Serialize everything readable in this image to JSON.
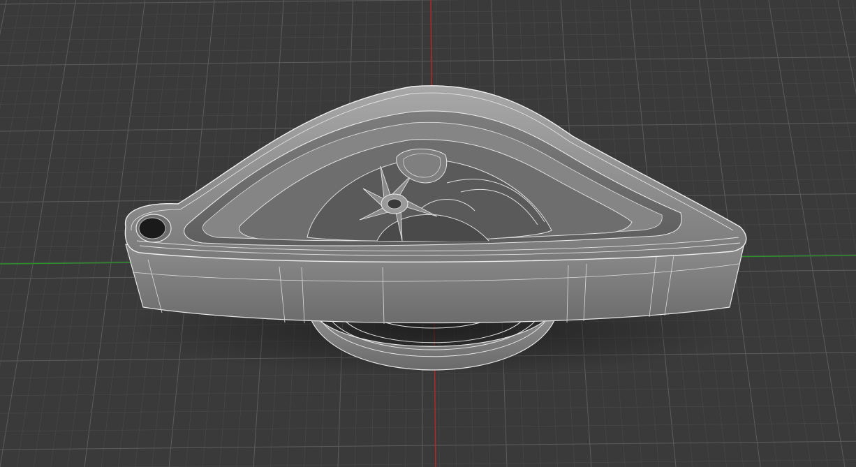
{
  "viewport": {
    "background_color": "#3a3a3a",
    "grid_minor_color": "#4a4a4a",
    "grid_major_color": "#5c5c5c",
    "axis_x_color": "#2f8f2f",
    "axis_y_color": "#b02a2a"
  },
  "model": {
    "material_color": "#8e8e8e",
    "edge_color": "#e6e6e6",
    "shadow_color": "#1e1e1e"
  }
}
